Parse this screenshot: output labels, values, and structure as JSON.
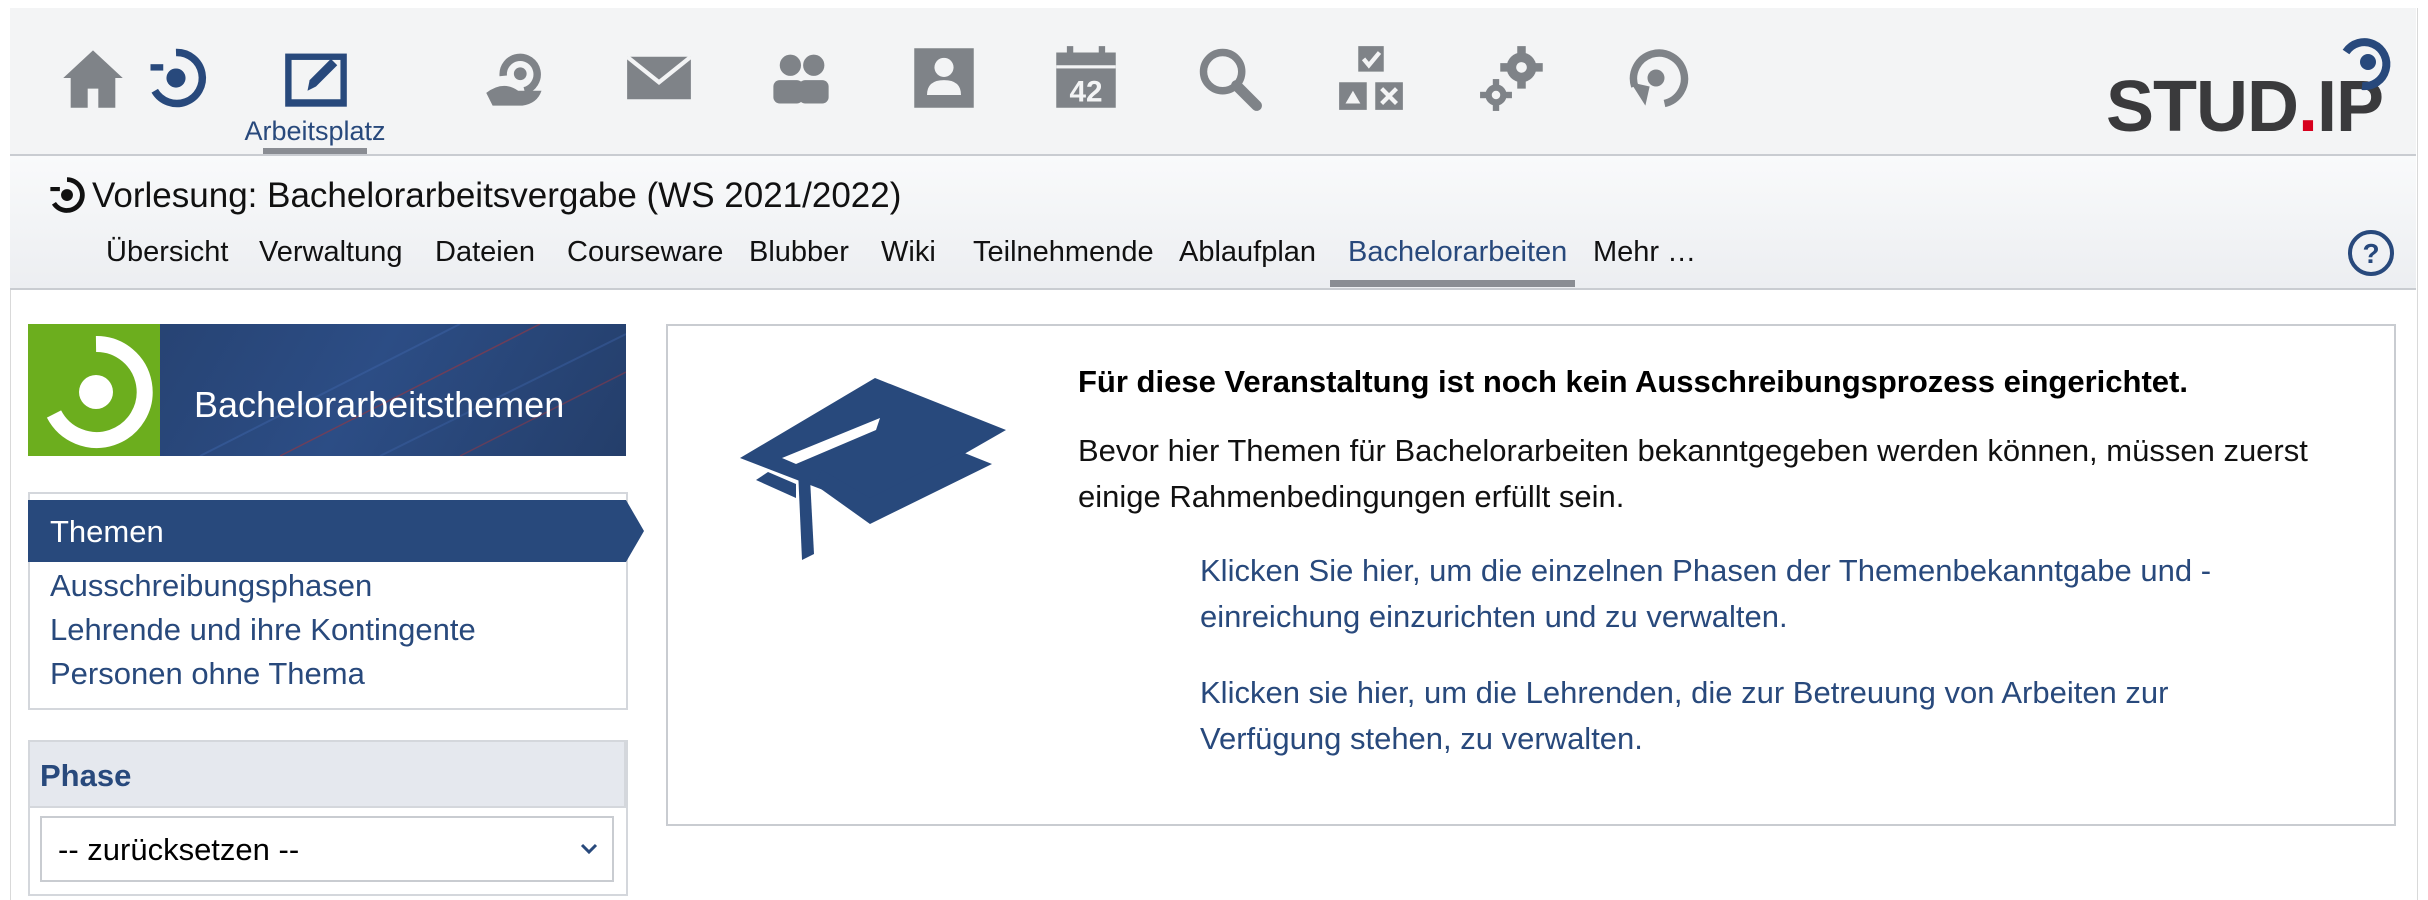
{
  "nav": {
    "items": [
      {
        "icon": "home-icon"
      },
      {
        "icon": "courses-icon"
      },
      {
        "icon": "workplace-icon",
        "label": "Arbeitsplatz"
      },
      {
        "icon": "community-icon"
      },
      {
        "icon": "mail-icon"
      },
      {
        "icon": "contacts-icon"
      },
      {
        "icon": "profile-icon"
      },
      {
        "icon": "calendar-icon",
        "badge": "42"
      },
      {
        "icon": "search-icon"
      },
      {
        "icon": "tools-icon"
      },
      {
        "icon": "admin-gear-icon"
      },
      {
        "icon": "studip-swirl-icon"
      }
    ]
  },
  "logo": {
    "text_main": "STUD",
    "text_dot": ".",
    "text_end": "IP"
  },
  "course": {
    "title": "Vorlesung: Bachelorarbeitsvergabe (WS 2021/2022)",
    "tabs": [
      "Übersicht",
      "Verwaltung",
      "Dateien",
      "Courseware",
      "Blubber",
      "Wiki",
      "Teilnehmende",
      "Ablaufplan",
      "Bachelorarbeiten",
      "Mehr …"
    ],
    "active_tab": "Bachelorarbeiten"
  },
  "sidebar": {
    "header_title": "Bachelorarbeitsthemen",
    "nav_active": "Themen",
    "nav_links": [
      "Ausschreibungsphasen",
      "Lehrende und ihre Kontingente",
      "Personen ohne Thema"
    ],
    "phase_title": "Phase",
    "phase_select_value": "-- zurücksetzen --"
  },
  "main": {
    "heading": "Für diese Veranstaltung ist noch kein Ausschreibungsprozess eingerichtet.",
    "text": "Bevor hier Themen für Bachelorarbeiten bekanntgegeben werden können, müssen zuerst einige Rahmenbedingungen erfüllt sein.",
    "link1": "Klicken Sie hier, um die einzelnen Phasen der Themenbekanntgabe und -einreichung einzurichten und zu verwalten.",
    "link2": "Klicken sie hier, um die Lehrenden, die zur Betreuung von Arbeiten zur Verfügung stehen, zu verwalten."
  },
  "colors": {
    "brand_blue": "#28497c",
    "icon_gray": "#7f8388",
    "studip_green": "#6cae1e",
    "logo_red": "#d7001d"
  }
}
